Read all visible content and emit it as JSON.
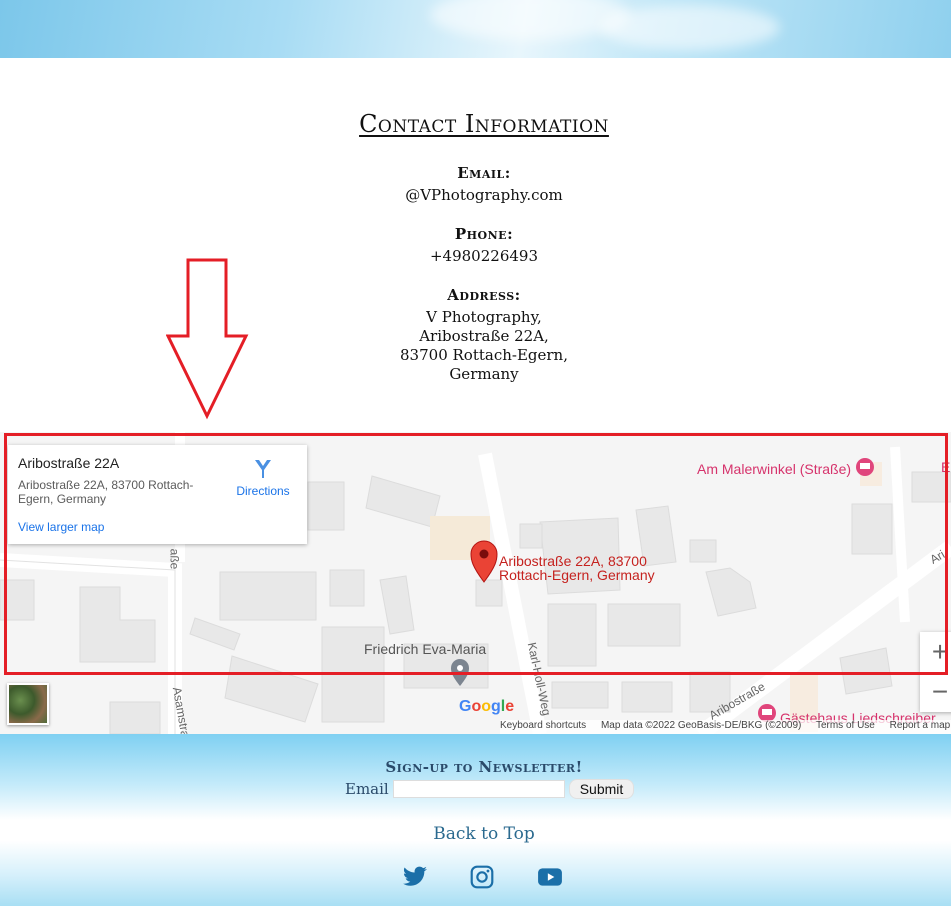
{
  "contact": {
    "title": "Contact Information",
    "email_label": "Email:",
    "email_value": "@VPhotography.com",
    "phone_label": "Phone:",
    "phone_value": "+4980226493",
    "address_label": "Address:",
    "address_lines": [
      "V Photography,",
      "Aribostraße 22A,",
      "83700 Rottach-Egern,",
      "Germany"
    ]
  },
  "map": {
    "card_title": "Aribostraße 22A",
    "card_address": "Aribostraße 22A, 83700 Rottach-Egern, Germany",
    "directions_label": "Directions",
    "view_larger": "View larger map",
    "pin_label_line1": "Aribostraße 22A, 83700",
    "pin_label_line2": "Rottach-Egern, Germany",
    "poi_malerwinkel": "Am Malerwinkel (Straße)",
    "poi_friedrich": "Friedrich Eva-Maria",
    "poi_gaestehaus": "Gästehaus Liedschreiber",
    "street_asam": "Asamstraße",
    "street_karl": "Karl-Holl-Weg",
    "street_aribo": "Aribostraße",
    "street_partial1": "aße",
    "street_partial2": "Ari",
    "poi_partial": "E",
    "zoom_in": "+",
    "zoom_out": "−",
    "google_logo": "Google",
    "attribution": {
      "shortcuts": "Keyboard shortcuts",
      "data": "Map data ©2022 GeoBasis-DE/BKG (©2009)",
      "terms": "Terms of Use",
      "report": "Report a map error"
    }
  },
  "footer": {
    "newsletter_title": "Sign-up to Newsletter!",
    "email_label": "Email",
    "email_value": "",
    "submit_label": "Submit",
    "back_to_top": "Back to Top",
    "social_icons": [
      "twitter-icon",
      "instagram-icon",
      "youtube-icon"
    ]
  },
  "colors": {
    "highlight_red": "#e41e26",
    "link_blue": "#1a73e8",
    "pin_red": "#ea4335",
    "footer_text": "#2a4a6a",
    "social_blue": "#1b6fa8"
  }
}
